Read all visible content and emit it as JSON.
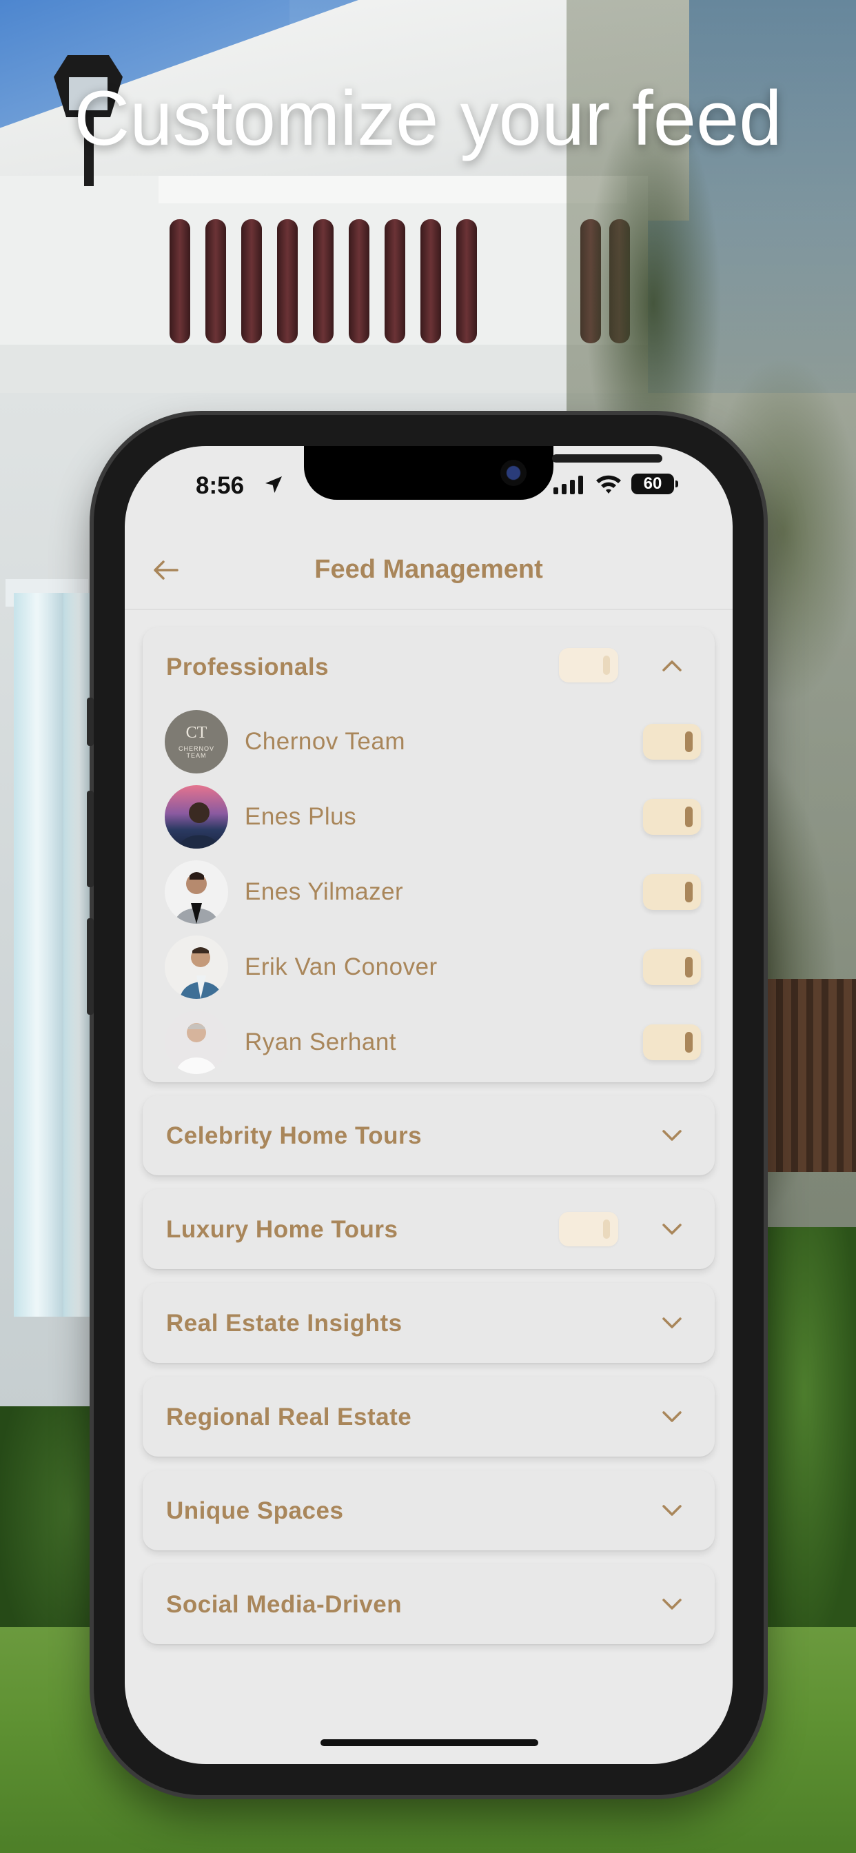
{
  "headline": "Customize your feed",
  "status_bar": {
    "time": "8:56",
    "battery": "60"
  },
  "header": {
    "title": "Feed Management"
  },
  "professionals": {
    "title": "Professionals",
    "members": [
      {
        "name": "Chernov Team",
        "avatar_monogram": "CT",
        "avatar_caption": "CHERNOV\nTEAM"
      },
      {
        "name": "Enes Plus"
      },
      {
        "name": "Enes Yilmazer"
      },
      {
        "name": "Erik Van Conover"
      },
      {
        "name": "Ryan Serhant"
      }
    ]
  },
  "categories": [
    {
      "title": "Celebrity Home Tours",
      "has_toggle": false
    },
    {
      "title": "Luxury Home Tours",
      "has_toggle": true
    },
    {
      "title": "Real Estate Insights",
      "has_toggle": false
    },
    {
      "title": "Regional Real Estate",
      "has_toggle": false
    },
    {
      "title": "Unique Spaces",
      "has_toggle": false
    },
    {
      "title": "Social Media-Driven",
      "has_toggle": false
    }
  ],
  "colors": {
    "accent": "#a9865a",
    "screen_bg": "#eaeaea",
    "card_bg": "#e8e8e8",
    "toggle_bg": "#f3e5ca"
  }
}
